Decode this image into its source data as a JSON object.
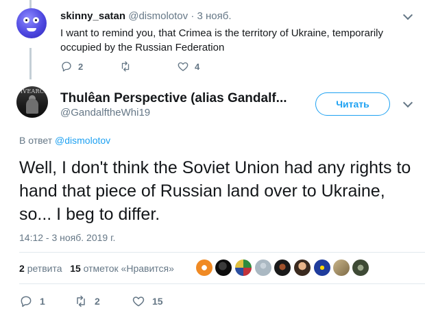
{
  "parent_tweet": {
    "name": "skinny_satan",
    "handle": "@dismolotov",
    "time": "· 3 нояб.",
    "text": "I want to remind you, that Crimea is the territory of Ukraine, temporarily occupied by the Russian Federation",
    "replies": "2",
    "retweets": "",
    "likes": "4"
  },
  "main_tweet": {
    "name": "Thulêan Perspective (alias Gandalf...",
    "handle": "@GandalftheWhi19",
    "follow_label": "Читать",
    "avatar_banner_text": "SIVEARCH",
    "reply_prefix": "В ответ",
    "reply_mention": "@dismolotov",
    "text": "Well, I don't think the Soviet Union had any rights to hand that piece of Russian land over to Ukraine, so... I beg to differ.",
    "timestamp": "14:12 - 3 нояб. 2019 г.",
    "retweet_count": "2",
    "retweet_label": "ретвита",
    "like_count": "15",
    "like_label": "отметок «Нравится»",
    "replies": "1",
    "retweets": "2",
    "likes": "15"
  },
  "colors": {
    "accent": "#1da1f2",
    "muted": "#657786",
    "text": "#14171a",
    "divider": "#e1e8ed"
  },
  "icons": {
    "reply": "reply-icon",
    "retweet": "retweet-icon",
    "like": "heart-icon",
    "menu": "chevron-down-icon"
  }
}
